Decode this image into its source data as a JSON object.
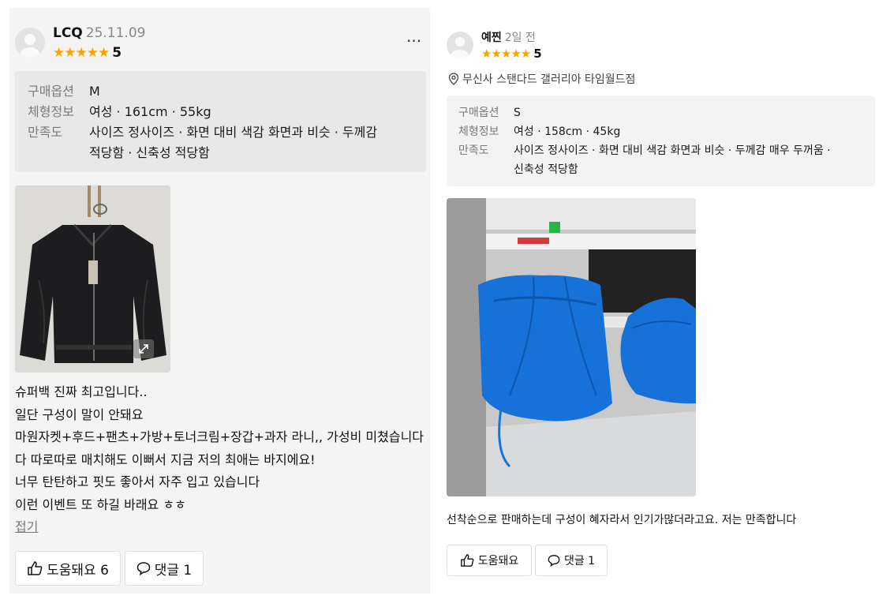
{
  "left_review": {
    "username": "LCQ",
    "date": "25.11.09",
    "rating_stars": "★★★★★",
    "rating": "5",
    "more_label": "···",
    "info": {
      "option_key": "구매옵션",
      "option_val": "M",
      "body_key": "체형정보",
      "body_val": "여성 · 161cm · 55kg",
      "satisfaction_key": "만족도",
      "satisfaction_val_line1": "사이즈 정사이즈 · 화면 대비 색감 화면과 비슷 · 두께감",
      "satisfaction_val_line2": "적당함 · 신축성 적당함"
    },
    "body_lines": [
      "슈퍼백 진짜 최고입니다..",
      "일단 구성이 말이 안돼요",
      "마원자켓+후드+팬츠+가방+토너크림+장갑+과자 라니,, 가성비 미쳤습니다",
      "다 따로따로 매치해도 이뻐서 지금 저의 최애는 바지에요!",
      "너무 탄탄하고 핏도 좋아서 자주 입고 있습니다",
      "이런 이벤트 또 하길 바래요 ㅎㅎ"
    ],
    "collapse_label": "접기",
    "helpful_label": "도움돼요 6",
    "comment_label": "댓글 1"
  },
  "right_review": {
    "username": "예찐",
    "date": "2일 전",
    "rating_stars": "★★★★★",
    "rating": "5",
    "store": "무신사 스탠다드 갤러리아 타임월드점",
    "info": {
      "option_key": "구매옵션",
      "option_val": "S",
      "body_key": "체형정보",
      "body_val": "여성 · 158cm · 45kg",
      "satisfaction_key": "만족도",
      "satisfaction_val_line1": "사이즈 정사이즈 · 화면 대비 색감 화면과 비슷 · 두께감 매우 두꺼움 ·",
      "satisfaction_val_line2": "신축성 적당함"
    },
    "body": "선착순으로 판매하는데 구성이 혜자라서 인기가많더라고요. 저는 만족합니다",
    "helpful_label": "도움돼요",
    "comment_label": "댓글 1"
  },
  "colors": {
    "star": "#f7a400",
    "left_bg": "#f4f4f4",
    "info_bg_left": "#e8e8e8",
    "info_bg_right": "#f3f3f3",
    "bag_blue": "#1672d8"
  }
}
